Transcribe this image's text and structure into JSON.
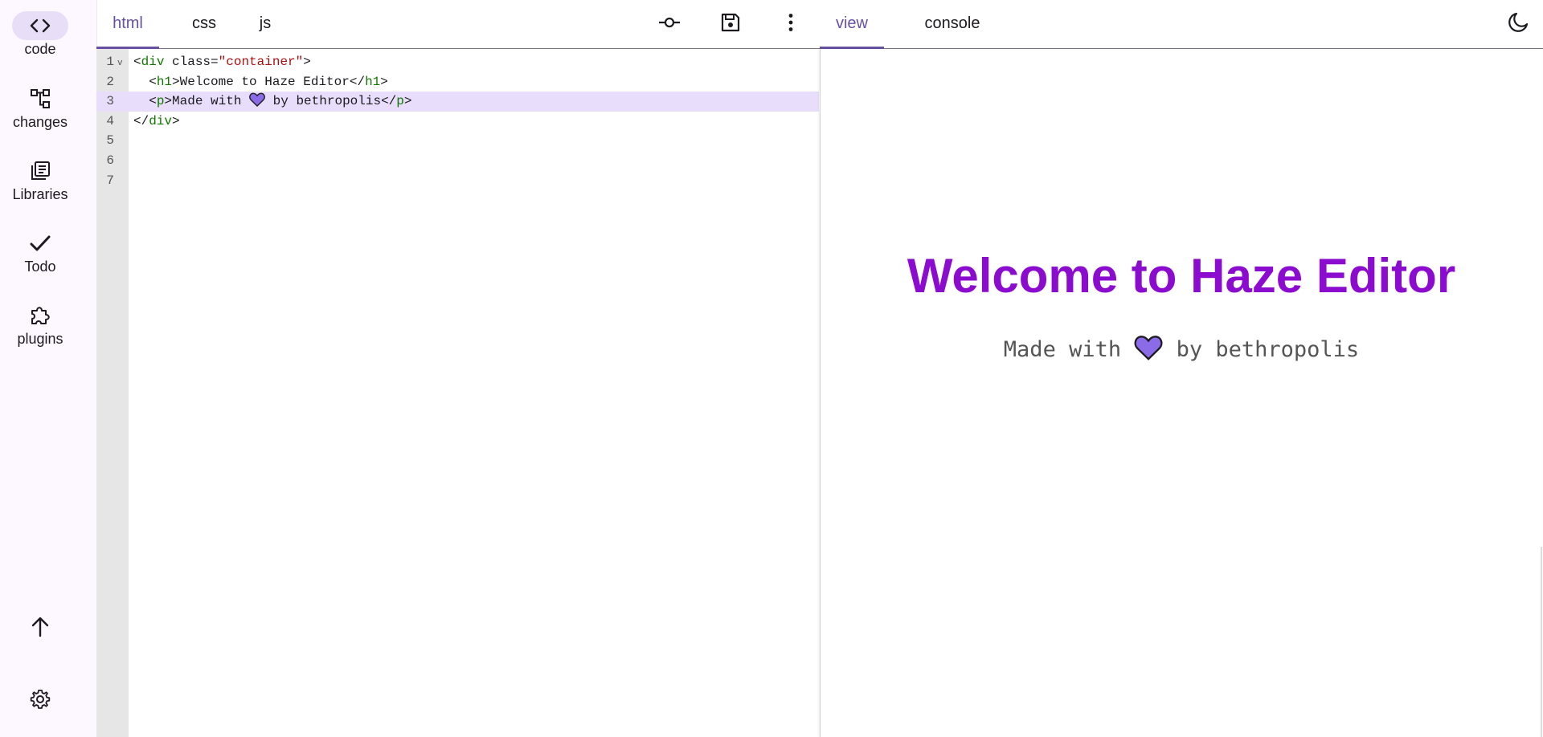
{
  "sidebar": {
    "items": [
      {
        "label": "code",
        "icon": "code-icon",
        "active": true
      },
      {
        "label": "changes",
        "icon": "changes-icon"
      },
      {
        "label": "Libraries",
        "icon": "libraries-icon"
      },
      {
        "label": "Todo",
        "icon": "check-icon"
      },
      {
        "label": "plugins",
        "icon": "puzzle-icon"
      }
    ],
    "bottom": [
      {
        "icon": "arrow-up-icon"
      },
      {
        "icon": "gear-icon"
      }
    ]
  },
  "editor_tabs": [
    {
      "label": "html",
      "active": true
    },
    {
      "label": "css",
      "active": false
    },
    {
      "label": "js",
      "active": false
    }
  ],
  "toolbar": {
    "commit": "commit-icon",
    "save": "save-icon",
    "more": "more-vert-icon"
  },
  "view_tabs": [
    {
      "label": "view",
      "active": true
    },
    {
      "label": "console",
      "active": false
    }
  ],
  "theme_toggle": "moon-icon",
  "code": {
    "line_numbers": [
      "1",
      "2",
      "3",
      "4",
      "5",
      "6",
      "7"
    ],
    "highlighted_line": 3,
    "lines": [
      [
        "<",
        "div",
        " class=",
        "\"container\"",
        ">"
      ],
      [
        "  <",
        "h1",
        ">Welcome to Haze Editor</",
        "h1",
        ">"
      ],
      [
        "  <",
        "p",
        ">Made with ",
        " by bethropolis</",
        "p",
        ">"
      ],
      [
        "</",
        "div",
        ">"
      ]
    ]
  },
  "preview": {
    "title": "Welcome to Haze Editor",
    "subtitle_before": "Made with ",
    "subtitle_after": " by bethropolis",
    "heart_color": "#8b6be8"
  },
  "colors": {
    "accent": "#6750a4",
    "title": "#8b0ccf",
    "highlight": "#e8defc"
  }
}
